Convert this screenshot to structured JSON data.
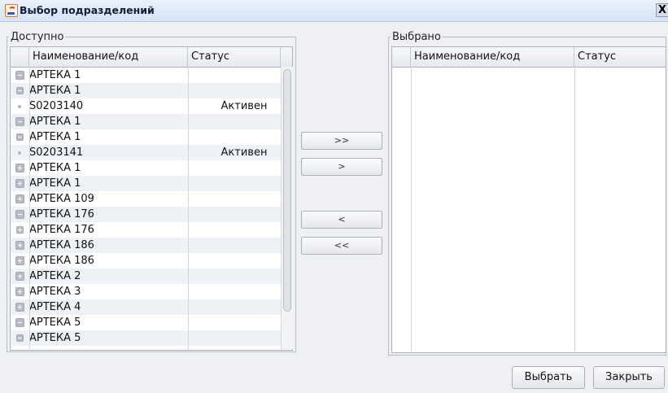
{
  "window": {
    "title": "Выбор подразделений",
    "close_label": "X"
  },
  "available": {
    "legend": "Доступно",
    "columns": {
      "name": "Наименование/код",
      "status": "Статус"
    },
    "rows": [
      {
        "name": "АРТЕКА 1",
        "status": "",
        "node": "minus"
      },
      {
        "name": "АРТЕКА 1",
        "status": "",
        "node": "minus-small"
      },
      {
        "name": "S0203140",
        "status": "Активен",
        "node": "leaf"
      },
      {
        "name": "АРТЕКА 1",
        "status": "",
        "node": "minus"
      },
      {
        "name": "АРТЕКА 1",
        "status": "",
        "node": "minus-small"
      },
      {
        "name": "S0203141",
        "status": "Активен",
        "node": "leaf"
      },
      {
        "name": "АРТЕКА 1",
        "status": "",
        "node": "plus"
      },
      {
        "name": "АРТЕКА 1",
        "status": "",
        "node": "plus"
      },
      {
        "name": "АРТЕКА 109",
        "status": "",
        "node": "plus"
      },
      {
        "name": "АРТЕКА 176",
        "status": "",
        "node": "minus"
      },
      {
        "name": "АРТЕКА 176",
        "status": "",
        "node": "plus-small"
      },
      {
        "name": "АРТЕКА 186",
        "status": "",
        "node": "plus"
      },
      {
        "name": "АРТЕКА 186",
        "status": "",
        "node": "plus"
      },
      {
        "name": "АРТЕКА 2",
        "status": "",
        "node": "plus"
      },
      {
        "name": "АРТЕКА 3",
        "status": "",
        "node": "plus"
      },
      {
        "name": "АРТЕКА 4",
        "status": "",
        "node": "plus"
      },
      {
        "name": "АРТЕКА 5",
        "status": "",
        "node": "minus"
      },
      {
        "name": "АРТЕКА 5",
        "status": "",
        "node": "minus-small"
      }
    ]
  },
  "selected": {
    "legend": "Выбрано",
    "columns": {
      "name": "Наименование/код",
      "status": "Статус"
    },
    "rows": []
  },
  "transfer": {
    "add_all": ">>",
    "add_one": ">",
    "remove_one": "<",
    "remove_all": "<<"
  },
  "actions": {
    "select": "Выбрать",
    "close": "Закрыть"
  }
}
